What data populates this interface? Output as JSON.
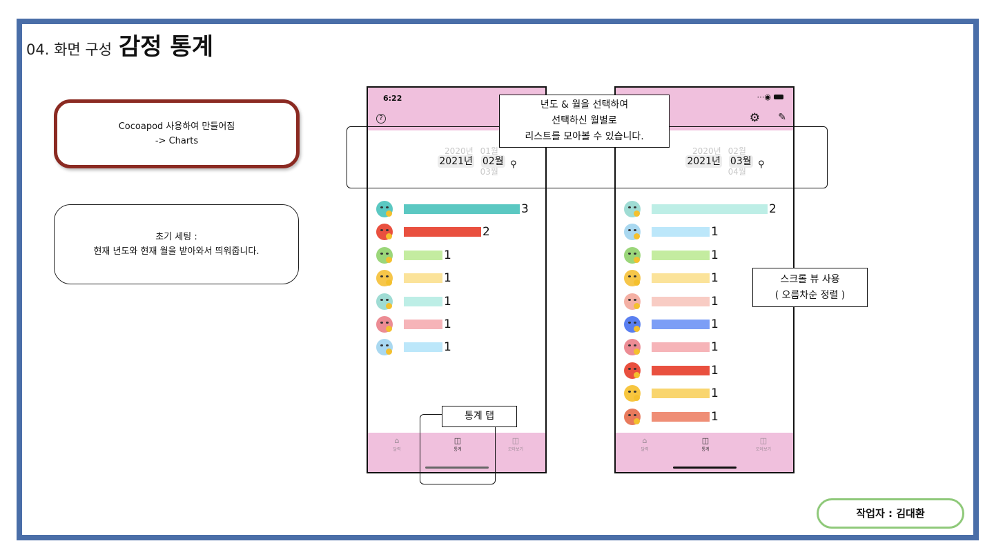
{
  "heading": {
    "section": "04. 화면 구성",
    "title": "감정 통계"
  },
  "notes": {
    "cocoapod": [
      "Cocoapod 사용하여 만들어짐",
      "-> Charts"
    ],
    "initial_setting": [
      "초기 세팅 :",
      "현재 년도와 현재 월을 받아와서 띄워줍니다."
    ]
  },
  "callouts": {
    "year_month": [
      "년도 & 월을 선택하여",
      "선택하신 월별로",
      "리스트를 모아볼 수 있습니다."
    ],
    "stats_tab": "통계 탭",
    "scroll_view": [
      "스크롤 뷰 사용",
      "( 오름차순 정렬 )"
    ]
  },
  "author": "작업자 : 김대환",
  "colors": {
    "frame": "#4a6ea8",
    "app_pink": "#f0c0dd",
    "note_border": "#8b2a22",
    "author_border": "#8fc97a"
  },
  "phones": [
    {
      "status_time": "6:22",
      "header_icons": [
        "help-icon"
      ],
      "picker": {
        "year_prev": "2020년",
        "year": "2021년",
        "month_prev": "01월",
        "month": "02월",
        "month_next": "03월"
      },
      "rows": [
        {
          "emotion_color": "#5bc8c2",
          "bar_color": "#5bc8c2",
          "value": 3
        },
        {
          "emotion_color": "#e9503f",
          "bar_color": "#e9503f",
          "value": 2
        },
        {
          "emotion_color": "#9bd67a",
          "bar_color": "#c4eca0",
          "value": 1
        },
        {
          "emotion_color": "#f6c64a",
          "bar_color": "#fbe39a",
          "value": 1
        },
        {
          "emotion_color": "#9fdcd4",
          "bar_color": "#bdeee6",
          "value": 1
        },
        {
          "emotion_color": "#ec8c94",
          "bar_color": "#f6b4b8",
          "value": 1
        },
        {
          "emotion_color": "#a9d8f0",
          "bar_color": "#bce7fa",
          "value": 1
        }
      ],
      "max_value": 3,
      "tabs": [
        "달력",
        "통계",
        "모아보기"
      ]
    },
    {
      "status_time": "",
      "header_icons": [
        "gear-icon",
        "edit-icon"
      ],
      "picker": {
        "year_prev": "2020년",
        "year": "2021년",
        "month_prev": "02월",
        "month": "03월",
        "month_next": "04월"
      },
      "rows": [
        {
          "emotion_color": "#9fdcd4",
          "bar_color": "#bdeee6",
          "value": 2
        },
        {
          "emotion_color": "#a9d8f0",
          "bar_color": "#bce7fa",
          "value": 1
        },
        {
          "emotion_color": "#9bd67a",
          "bar_color": "#c4eca0",
          "value": 1
        },
        {
          "emotion_color": "#f6c64a",
          "bar_color": "#fbe39a",
          "value": 1
        },
        {
          "emotion_color": "#f4b0a4",
          "bar_color": "#f8ccc4",
          "value": 1
        },
        {
          "emotion_color": "#5a7ff0",
          "bar_color": "#7c9ef6",
          "value": 1
        },
        {
          "emotion_color": "#ec8c94",
          "bar_color": "#f6b4b8",
          "value": 1
        },
        {
          "emotion_color": "#e9503f",
          "bar_color": "#e9503f",
          "value": 1
        },
        {
          "emotion_color": "#f7c640",
          "bar_color": "#f9d56e",
          "value": 1
        },
        {
          "emotion_color": "#e87a5c",
          "bar_color": "#ef8e76",
          "value": 1
        }
      ],
      "max_value": 2,
      "tabs": [
        "달력",
        "통계",
        "모아보기"
      ]
    }
  ]
}
